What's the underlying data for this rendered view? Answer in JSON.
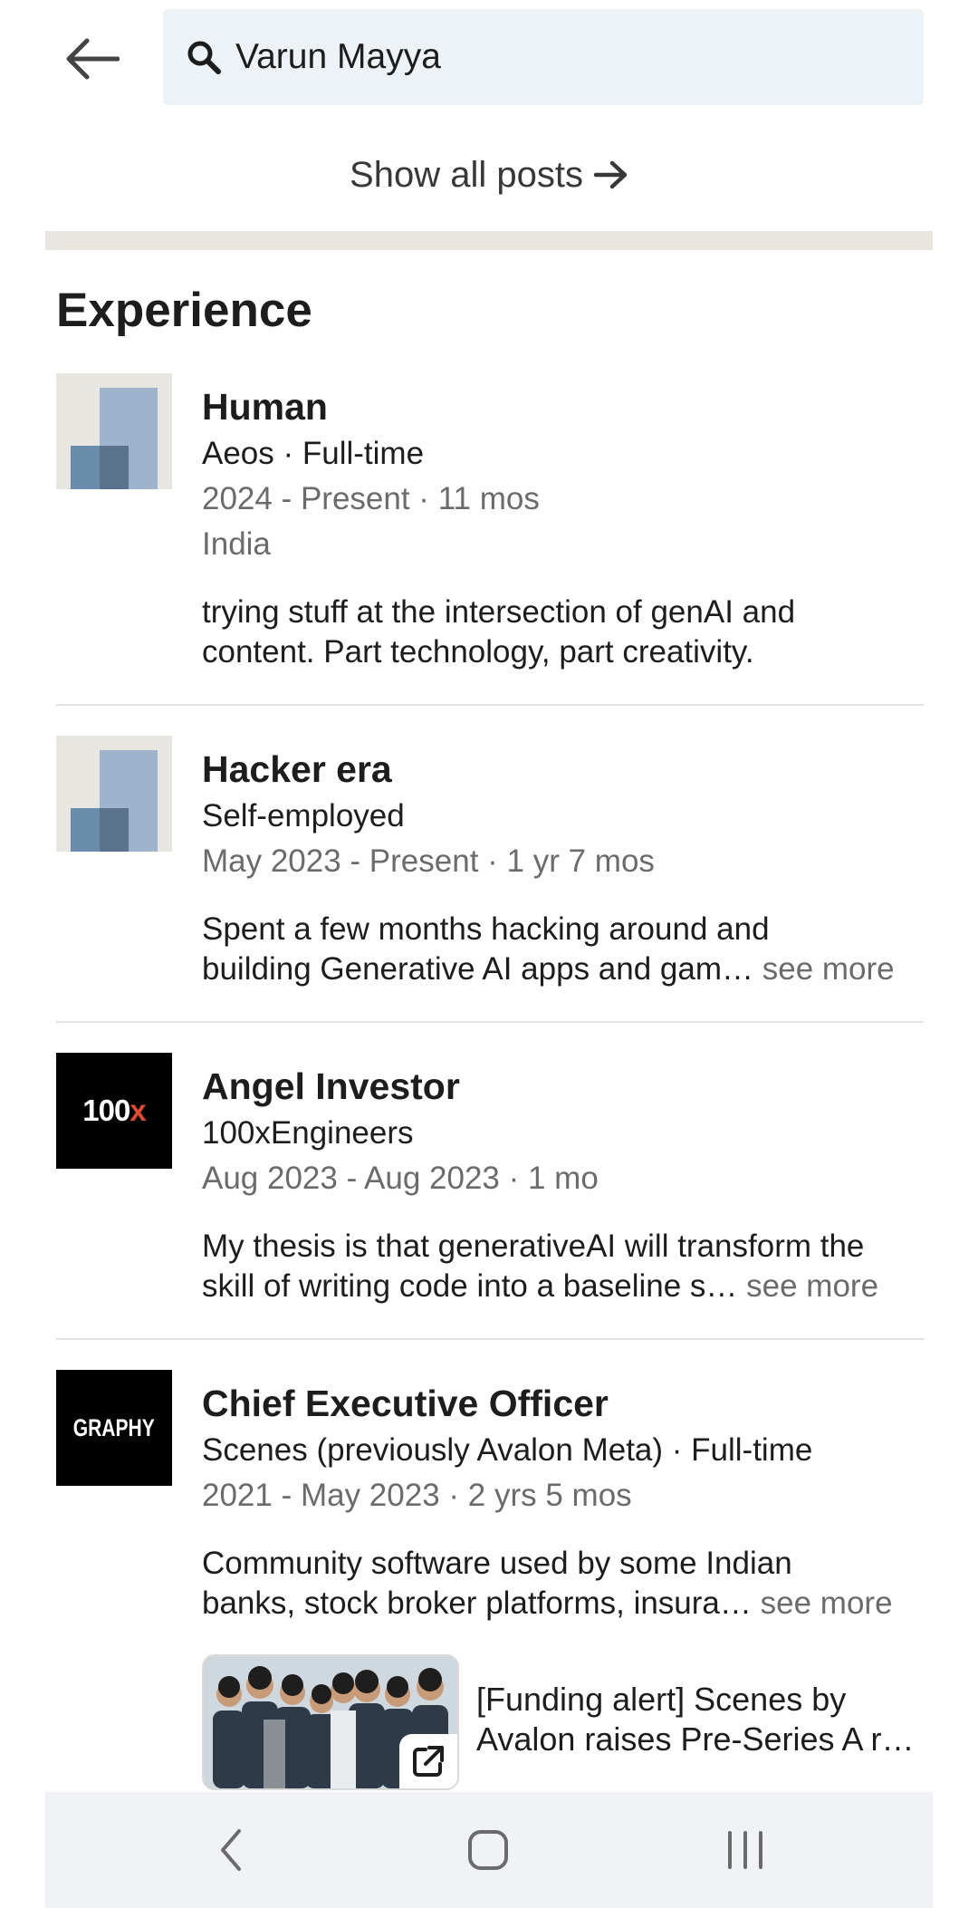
{
  "search": {
    "value": "Varun Mayya"
  },
  "show_all_posts": "Show all posts",
  "section_title": "Experience",
  "experiences": [
    {
      "title": "Human",
      "subtitle": "Aeos · Full-time",
      "dates": "2024 - Present · 11 mos",
      "location": "India",
      "desc_line1": "trying stuff at the intersection of genAI and",
      "desc_line2": "content. Part technology, part creativity.",
      "logo": "placeholder-company-logo"
    },
    {
      "title": "Hacker era",
      "subtitle": "Self-employed",
      "dates": "May 2023 - Present · 1 yr 7 mos",
      "desc_line1": "Spent a few months hacking around and",
      "desc_line2": "building Generative AI apps and gam…",
      "see_more": "see more",
      "logo": "placeholder-company-logo"
    },
    {
      "title": "Angel Investor",
      "subtitle": "100xEngineers",
      "dates": "Aug 2023 - Aug 2023 · 1 mo",
      "desc_line1": "My thesis is that generativeAI will transform the",
      "desc_line2": "skill of writing code into a baseline s…",
      "see_more": "see more",
      "logo_text_main": "100",
      "logo_text_accent": "x"
    },
    {
      "title": "Chief Executive Officer",
      "subtitle": "Scenes (previously Avalon Meta) · Full-time",
      "dates": "2021 - May 2023 · 2 yrs 5 mos",
      "desc_line1": "Community software used by some Indian",
      "desc_line2": "banks, stock broker platforms, insura…",
      "see_more": "see more",
      "logo_text": "GRAPHY",
      "media": {
        "title_line1": "[Funding alert] Scenes by",
        "title_line2": "Avalon raises Pre-Series A r…",
        "icon": "external-link-icon"
      }
    }
  ],
  "colors": {
    "search_bg": "#edf2f6",
    "divider_band": "#e9e6df",
    "muted_text": "#6b6b6b",
    "accent_x": "#e44a2f",
    "navbar_bg": "#f1f2f5"
  },
  "icons": [
    "back-arrow-icon",
    "search-icon",
    "right-arrow-icon",
    "external-link-icon",
    "nav-back-icon",
    "nav-home-icon",
    "nav-recents-icon"
  ]
}
